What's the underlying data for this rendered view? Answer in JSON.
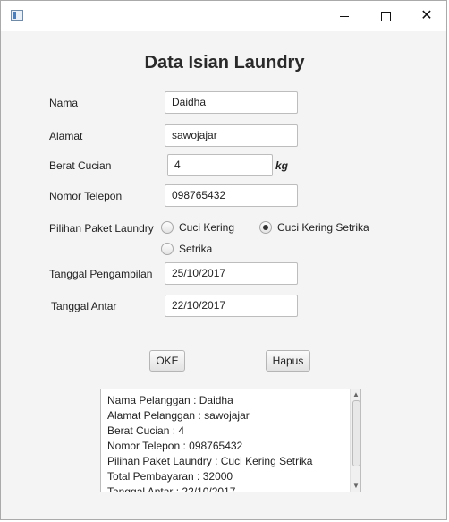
{
  "window": {
    "title_icon": "app-window-icon"
  },
  "form": {
    "heading": "Data Isian Laundry",
    "nama_label": "Nama",
    "nama_value": "Daidha",
    "alamat_label": "Alamat",
    "alamat_value": "sawojajar",
    "berat_label": "Berat Cucian",
    "berat_value": "4",
    "berat_unit": "kg",
    "telepon_label": "Nomor Telepon",
    "telepon_value": "098765432",
    "paket_label": "Pilihan Paket Laundry",
    "paket_options": [
      "Cuci Kering",
      "Cuci Kering Setrika",
      "Setrika"
    ],
    "paket_selected": "Cuci Kering Setrika",
    "pengambilan_label": "Tanggal Pengambilan",
    "pengambilan_value": "25/10/2017",
    "antar_label": "Tanggal Antar",
    "antar_value": "22/10/2017"
  },
  "buttons": {
    "oke": "OKE",
    "hapus": "Hapus"
  },
  "output": {
    "lines": [
      "Nama Pelanggan : Daidha",
      "Alamat Pelanggan : sawojajar",
      "Berat Cucian : 4",
      "Nomor Telepon : 098765432",
      "Pilihan Paket Laundry : Cuci Kering Setrika",
      "Total Pembayaran : 32000",
      "Tanggal Antar : 22/10/2017"
    ]
  }
}
